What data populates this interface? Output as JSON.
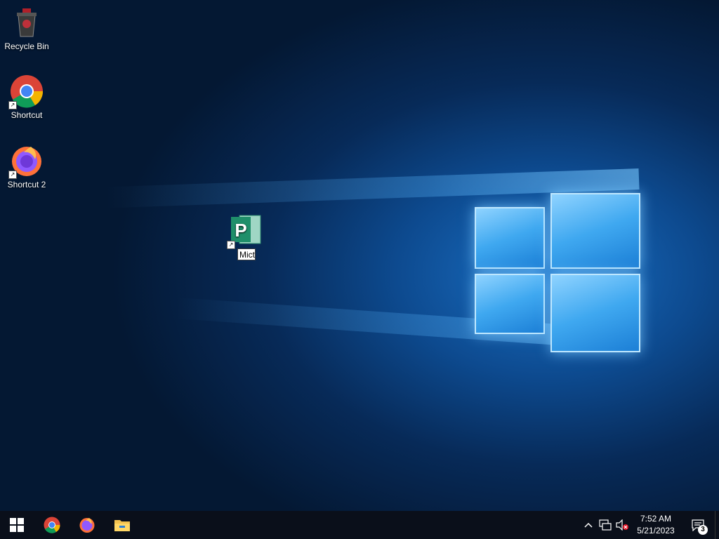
{
  "desktop": {
    "icons": [
      {
        "label": "Recycle Bin"
      },
      {
        "label": "Shortcut"
      },
      {
        "label": "Shortcut 2"
      }
    ],
    "rename_value": "Mict"
  },
  "taskbar": {
    "time": "7:52 AM",
    "date": "5/21/2023",
    "notification_count": "3"
  },
  "colors": {
    "taskbar_bg": "#0a0f1a",
    "accent": "#1a6fc4"
  }
}
